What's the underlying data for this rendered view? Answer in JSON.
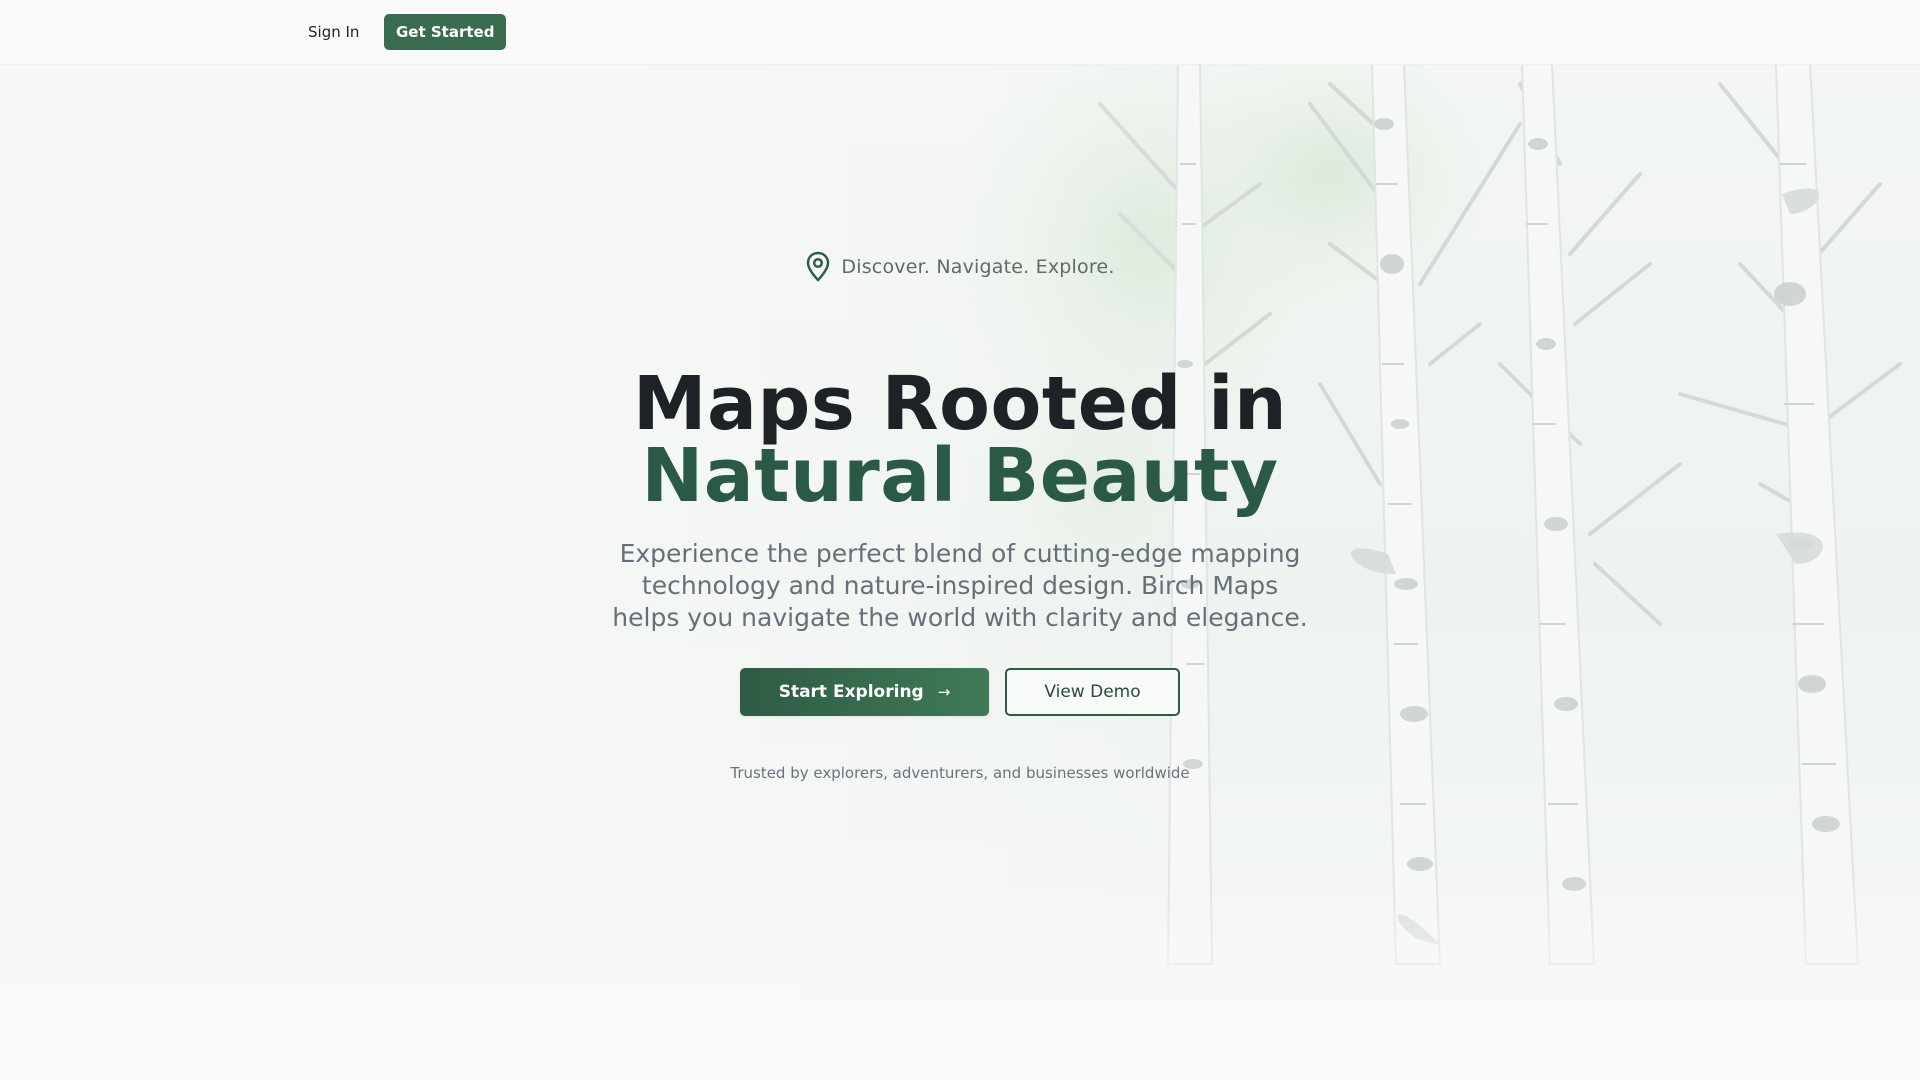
{
  "nav": {
    "sign_in": "Sign In",
    "get_started": "Get Started"
  },
  "hero": {
    "tagline": "Discover. Navigate. Explore.",
    "tagline_icon": "map-pin-icon",
    "title_line1": "Maps Rooted in",
    "title_line2": "Natural Beauty",
    "description": "Experience the perfect blend of cutting-edge mapping technology and nature-inspired design. Birch Maps helps you navigate the world with clarity and elegance.",
    "primary_button": "Start Exploring",
    "primary_button_icon": "arrow-right-icon",
    "secondary_button": "View Demo",
    "trusted_text": "Trusted by explorers, adventurers, and businesses worldwide"
  },
  "colors": {
    "accent": "#3a6b4f",
    "title_dark": "#1c2226",
    "title_green": "#2a5a45",
    "muted_text": "#66707a",
    "background": "#f3f6f3"
  }
}
